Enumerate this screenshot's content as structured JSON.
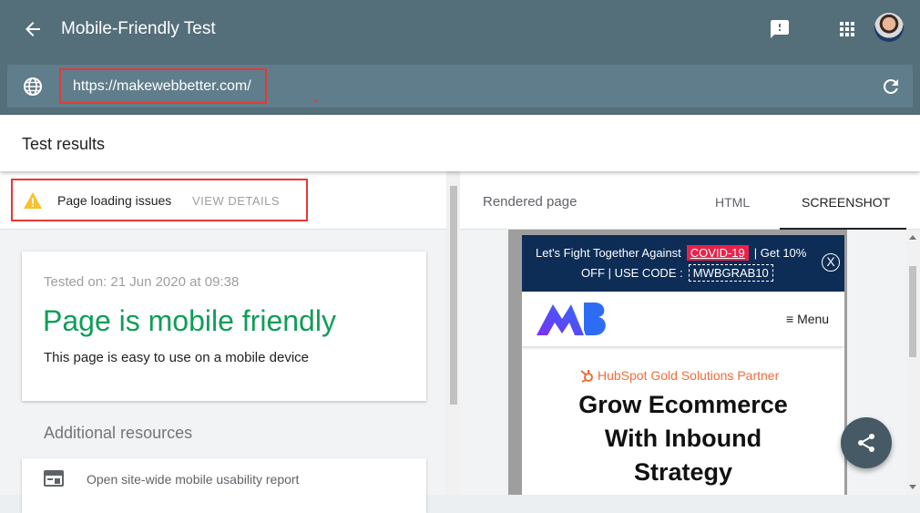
{
  "header": {
    "title": "Mobile-Friendly Test"
  },
  "url_bar": {
    "value": "https://makewebbetter.com/"
  },
  "results": {
    "title": "Test results"
  },
  "issues": {
    "label": "Page loading issues",
    "action": "VIEW DETAILS"
  },
  "result_card": {
    "tested_on": "Tested on: 21 Jun 2020 at 09:38",
    "verdict": "Page is mobile friendly",
    "verdict_sub": "This page is easy to use on a mobile device",
    "verdict_color": "#0f9d58"
  },
  "resources": {
    "title": "Additional resources",
    "items": [
      {
        "label": "Open site-wide mobile usability report"
      }
    ]
  },
  "right_panel": {
    "rendered_label": "Rendered page",
    "tabs": [
      {
        "label": "HTML",
        "active": false
      },
      {
        "label": "SCREENSHOT",
        "active": true
      }
    ]
  },
  "screenshot": {
    "promo_line1_prefix": "Let's Fight Together Against",
    "promo_covid": "COVID-19",
    "promo_line1_suffix": "| Get 10%",
    "promo_line2_prefix": "OFF | USE CODE :",
    "promo_code": "MWBGRAB10",
    "promo_close": "X",
    "menu_label": "Menu",
    "menu_glyph": "≡",
    "partner": "HubSpot Gold Solutions Partner",
    "headline_lines": [
      "Grow Ecommerce",
      "With Inbound",
      "Strategy"
    ]
  },
  "icons": {
    "back": "arrow-back-icon",
    "feedback": "feedback-icon",
    "apps": "apps-grid-icon",
    "globe": "globe-icon",
    "reload": "reload-icon",
    "warning": "warning-icon",
    "report": "report-icon",
    "share": "share-icon"
  },
  "colors": {
    "header_bg": "#546e7a",
    "highlight_border": "#e53935",
    "warning": "#fbc02d",
    "promo_bg": "#0d2d56",
    "covid_bg": "#e8224b"
  }
}
